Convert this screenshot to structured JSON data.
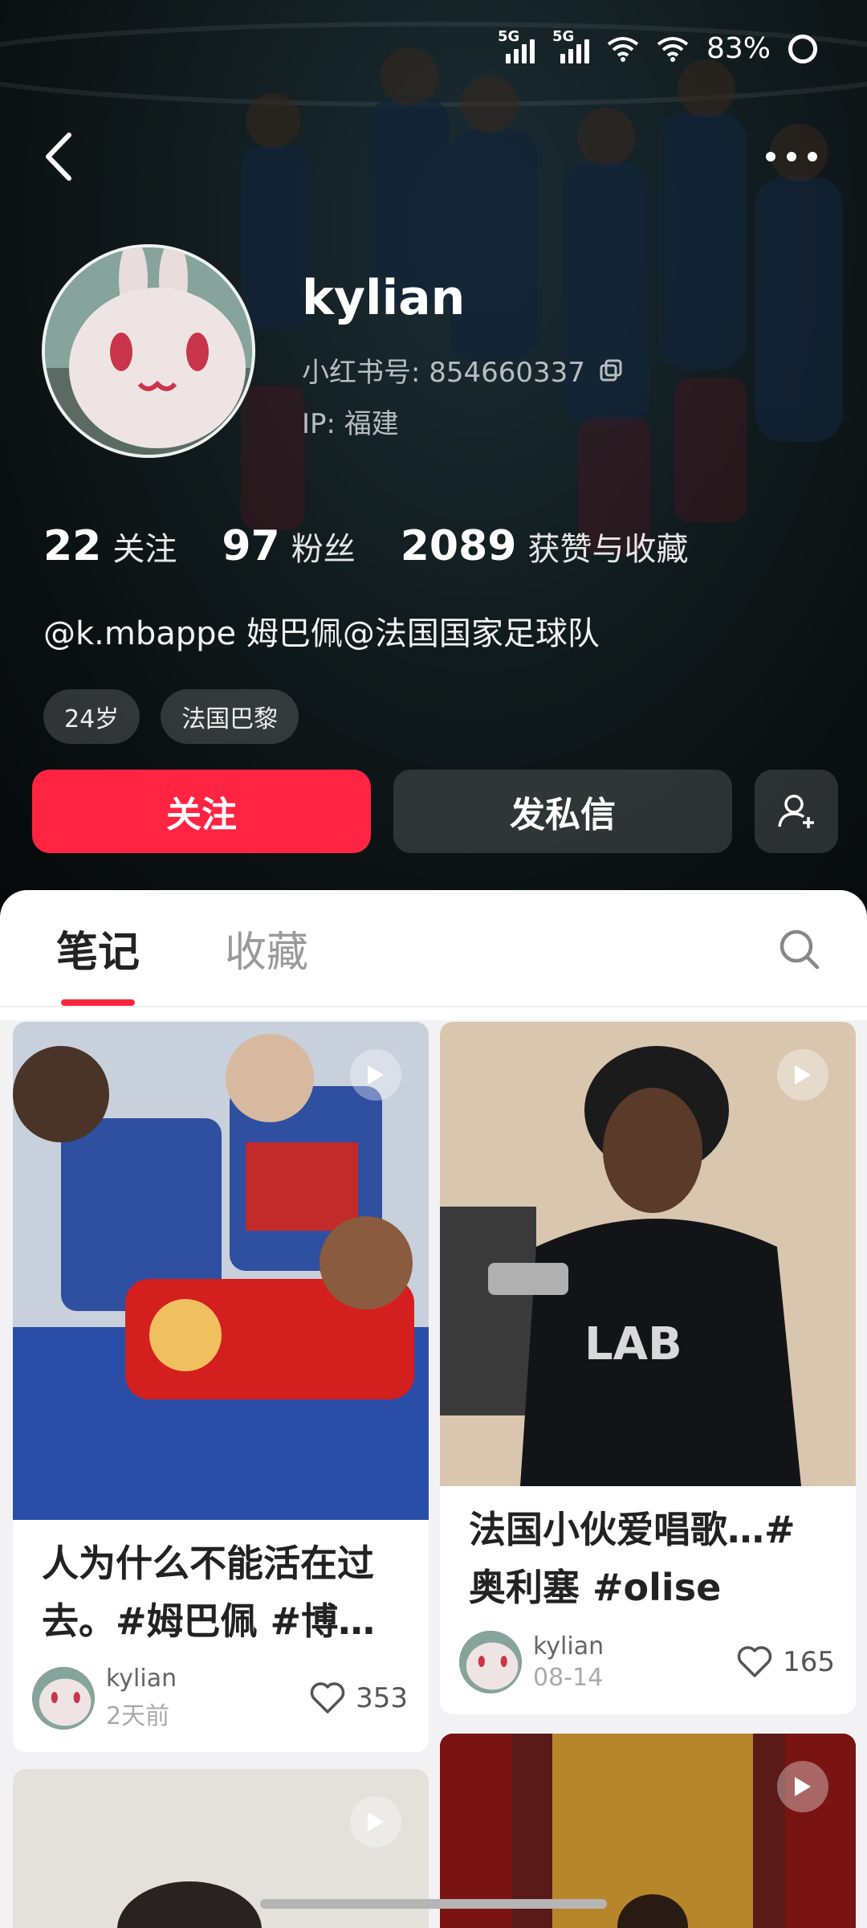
{
  "status_bar": {
    "signal1_label": "5G",
    "signal2_label": "5G",
    "battery": "83%"
  },
  "profile": {
    "username": "kylian",
    "redbook_id": "小红书号: 854660337",
    "ip": "IP: 福建",
    "stats": [
      {
        "num": "22",
        "label": "关注"
      },
      {
        "num": "97",
        "label": "粉丝"
      },
      {
        "num": "2089",
        "label": "获赞与收藏"
      }
    ],
    "bio": "@k.mbappe 姆巴佩@法国国家足球队",
    "tags": [
      "24岁",
      "法国巴黎"
    ],
    "follow_label": "关注",
    "message_label": "发私信"
  },
  "tabs": {
    "notes": "笔记",
    "favorites": "收藏"
  },
  "feed": [
    {
      "title": "人为什么不能活在过去。#姆巴佩 #博…",
      "author": "kylian",
      "date": "2天前",
      "likes": "353"
    },
    {
      "title": "法国小伙爱唱歌…#奥利塞 #olise",
      "author": "kylian",
      "date": "08-14",
      "likes": "165"
    }
  ],
  "colors": {
    "accent": "#ff2442"
  }
}
